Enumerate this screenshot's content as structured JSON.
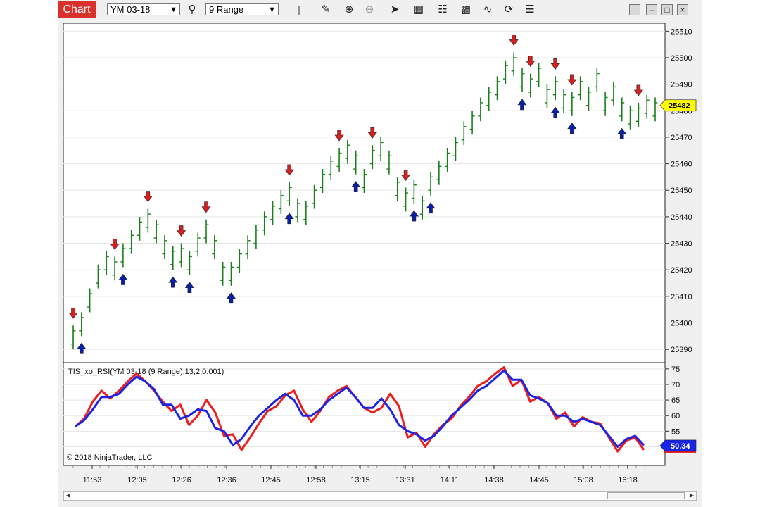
{
  "toolbar": {
    "tab_label": "Chart",
    "instrument": "YM 03-18",
    "bar_type": "9 Range",
    "icons": [
      "search-icon",
      "bars-icon",
      "pencil-icon",
      "zoom-in-icon",
      "zoom-out-icon",
      "pointer-icon",
      "data-box-icon",
      "properties-icon",
      "templates-icon",
      "drawing-tools-icon",
      "reload-icon",
      "list-icon"
    ]
  },
  "colors": {
    "bar": "#1a7f1a",
    "down_arrow": "#d42020",
    "up_arrow": "#0a1fa8",
    "rsi_red": "#ee1c1c",
    "rsi_blue": "#1a24e6",
    "price_marker": "#ffff00",
    "rsi_marker": "#1a24e6"
  },
  "copyright": "© 2018 NinjaTrader, LLC",
  "chart_data": [
    {
      "type": "ohlc",
      "ylim": [
        25385,
        25513
      ],
      "yticks": [
        25390,
        25400,
        25410,
        25420,
        25430,
        25440,
        25450,
        25460,
        25470,
        25480,
        25490,
        25500,
        25510
      ],
      "xticks": [
        "11:53",
        "12:05",
        "12:26",
        "12:36",
        "12:45",
        "12:58",
        "13:15",
        "13:31",
        "14:11",
        "14:38",
        "14:45",
        "15:08",
        "16:18"
      ],
      "last_price": "25482",
      "bars": [
        [
          25390,
          25399
        ],
        [
          25395,
          25404
        ],
        [
          25404,
          25413
        ],
        [
          25413,
          25422
        ],
        [
          25418,
          25427
        ],
        [
          25416,
          25425
        ],
        [
          25421,
          25430
        ],
        [
          25426,
          25435
        ],
        [
          25431,
          25440
        ],
        [
          25434,
          25443
        ],
        [
          25430,
          25439
        ],
        [
          25424,
          25433
        ],
        [
          25420,
          25429
        ],
        [
          25421,
          25430
        ],
        [
          25418,
          25427
        ],
        [
          25425,
          25434
        ],
        [
          25430,
          25439
        ],
        [
          25424,
          25433
        ],
        [
          25414,
          25423
        ],
        [
          25414,
          25423
        ],
        [
          25419,
          25428
        ],
        [
          25424,
          25433
        ],
        [
          25428,
          25437
        ],
        [
          25433,
          25442
        ],
        [
          25437,
          25446
        ],
        [
          25441,
          25450
        ],
        [
          25444,
          25453
        ],
        [
          25438,
          25447
        ],
        [
          25437,
          25446
        ],
        [
          25443,
          25452
        ],
        [
          25449,
          25458
        ],
        [
          25454,
          25463
        ],
        [
          25457,
          25466
        ],
        [
          25460,
          25469
        ],
        [
          25456,
          25465
        ],
        [
          25449,
          25458
        ],
        [
          25458,
          25467
        ],
        [
          25461,
          25470
        ],
        [
          25456,
          25465
        ],
        [
          25446,
          25455
        ],
        [
          25442,
          25451
        ],
        [
          25445,
          25454
        ],
        [
          25439,
          25448
        ],
        [
          25448,
          25457
        ],
        [
          25452,
          25461
        ],
        [
          25457,
          25466
        ],
        [
          25461,
          25470
        ],
        [
          25467,
          25476
        ],
        [
          25471,
          25480
        ],
        [
          25476,
          25485
        ],
        [
          25480,
          25489
        ],
        [
          25484,
          25493
        ],
        [
          25490,
          25499
        ],
        [
          25493,
          25502
        ],
        [
          25487,
          25496
        ],
        [
          25485,
          25494
        ],
        [
          25489,
          25498
        ],
        [
          25481,
          25490
        ],
        [
          25484,
          25493
        ],
        [
          25479,
          25488
        ],
        [
          25478,
          25487
        ],
        [
          25484,
          25493
        ],
        [
          25480,
          25489
        ],
        [
          25487,
          25496
        ],
        [
          25478,
          25487
        ],
        [
          25482,
          25491
        ],
        [
          25476,
          25485
        ],
        [
          25473,
          25482
        ],
        [
          25474,
          25483
        ],
        [
          25477,
          25486
        ],
        [
          25476,
          25485
        ]
      ],
      "up_arrows": [
        1,
        6,
        12,
        14,
        19,
        26,
        34,
        41,
        43,
        54,
        58,
        60,
        66
      ],
      "down_arrows": [
        0,
        5,
        9,
        13,
        16,
        26,
        32,
        36,
        40,
        53,
        55,
        58,
        60,
        68
      ]
    },
    {
      "type": "line",
      "title": "TIS_xo_RSI(YM 03-18 (9 Range),13,2,0.001)",
      "ylim": [
        44,
        77
      ],
      "yticks": [
        50,
        55,
        60,
        65,
        70,
        75
      ],
      "last_value": "50.34",
      "series": [
        {
          "color": "red",
          "values": [
            56.5,
            59,
            64.5,
            68,
            65.5,
            68,
            71,
            73.5,
            71,
            68,
            64.5,
            61.5,
            63.5,
            57,
            60,
            65,
            61,
            53.5,
            54,
            49,
            53,
            57.5,
            61.5,
            63,
            66.5,
            68,
            62,
            58,
            61.5,
            66,
            68,
            69.5,
            66,
            62.5,
            61,
            62.5,
            67,
            63,
            53,
            54.5,
            50,
            54,
            57,
            59,
            63,
            66,
            69.5,
            71,
            73.5,
            75.5,
            69.5,
            71.5,
            64.5,
            66,
            64,
            59,
            61,
            56.5,
            59.5,
            58,
            57.5,
            53,
            48.5,
            52,
            53,
            49
          ]
        },
        {
          "color": "blue",
          "values": [
            56.5,
            58.5,
            62,
            66,
            66,
            67,
            70,
            72.5,
            71,
            68.5,
            63.5,
            63.5,
            59,
            60,
            62,
            61.5,
            56,
            55,
            50.5,
            52.5,
            56.5,
            60,
            62.5,
            65,
            67,
            65,
            60,
            60,
            62,
            65,
            67,
            69,
            66,
            62.5,
            62.5,
            65.5,
            62,
            57,
            55,
            54,
            52,
            53.5,
            56.5,
            60,
            62.5,
            65,
            68,
            69.5,
            72,
            74.5,
            71.5,
            71.5,
            66.5,
            65.5,
            64,
            60,
            60,
            58,
            59,
            58,
            57,
            53.5,
            50,
            52.5,
            53.5,
            50.5
          ]
        }
      ]
    }
  ]
}
